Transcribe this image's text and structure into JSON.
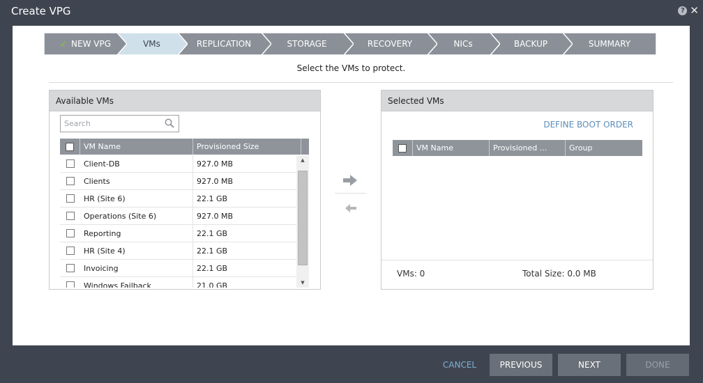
{
  "window": {
    "title": "Create VPG"
  },
  "steps": [
    {
      "label": "NEW VPG",
      "state": "complete"
    },
    {
      "label": "VMs",
      "state": "active"
    },
    {
      "label": "REPLICATION",
      "state": "pending"
    },
    {
      "label": "STORAGE",
      "state": "pending"
    },
    {
      "label": "RECOVERY",
      "state": "pending"
    },
    {
      "label": "NICs",
      "state": "pending"
    },
    {
      "label": "BACKUP",
      "state": "pending"
    },
    {
      "label": "SUMMARY",
      "state": "pending"
    }
  ],
  "instruction": "Select the VMs to protect.",
  "available": {
    "title": "Available VMs",
    "search_placeholder": "Search",
    "columns": [
      "VM Name",
      "Provisioned Size"
    ],
    "rows": [
      {
        "name": "Client-DB",
        "size": "927.0 MB"
      },
      {
        "name": "Clients",
        "size": "927.0 MB"
      },
      {
        "name": "HR (Site 6)",
        "size": "22.1 GB"
      },
      {
        "name": "Operations (Site 6)",
        "size": "927.0 MB"
      },
      {
        "name": "Reporting",
        "size": "22.1 GB"
      },
      {
        "name": "HR (Site 4)",
        "size": "22.1 GB"
      },
      {
        "name": "Invoicing",
        "size": "22.1 GB"
      },
      {
        "name": "Windows Failback",
        "size": "21.0 GB"
      }
    ]
  },
  "selected": {
    "title": "Selected VMs",
    "define_boot_order": "DEFINE BOOT ORDER",
    "columns": [
      "VM Name",
      "Provisioned ...",
      "Group"
    ],
    "vms_count": "VMs: 0",
    "total_size": "Total Size: 0.0 MB"
  },
  "footer": {
    "cancel": "CANCEL",
    "previous": "PREVIOUS",
    "next": "NEXT",
    "done": "DONE"
  },
  "colors": {
    "frame": "#3f4550",
    "step_bg": "#8b9098",
    "step_active_bg": "#cfe0ea",
    "check": "#7ed321",
    "link": "#5b8db8"
  }
}
